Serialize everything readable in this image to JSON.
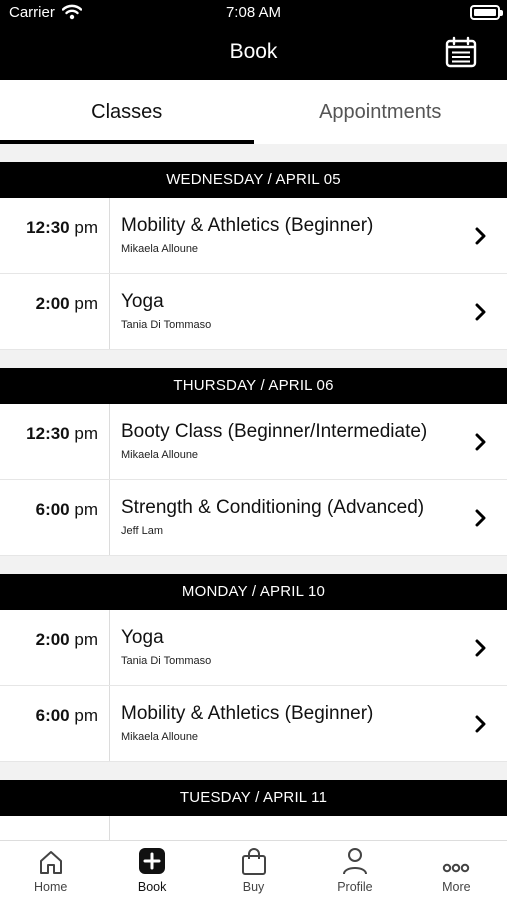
{
  "status_bar": {
    "carrier": "Carrier",
    "time": "7:08 AM"
  },
  "header": {
    "title": "Book"
  },
  "tabs": [
    {
      "label": "Classes",
      "active": true
    },
    {
      "label": "Appointments",
      "active": false
    }
  ],
  "days": [
    {
      "header": "WEDNESDAY / APRIL 05",
      "classes": [
        {
          "time": "12:30",
          "ampm": "pm",
          "name": "Mobility & Athletics (Beginner)",
          "instructor": "Mikaela Alloune"
        },
        {
          "time": "2:00",
          "ampm": "pm",
          "name": "Yoga",
          "instructor": "Tania Di Tommaso"
        }
      ]
    },
    {
      "header": "THURSDAY / APRIL 06",
      "classes": [
        {
          "time": "12:30",
          "ampm": "pm",
          "name": "Booty Class (Beginner/Intermediate)",
          "instructor": "Mikaela Alloune"
        },
        {
          "time": "6:00",
          "ampm": "pm",
          "name": "Strength & Conditioning (Advanced)",
          "instructor": "Jeff Lam"
        }
      ]
    },
    {
      "header": "MONDAY / APRIL 10",
      "classes": [
        {
          "time": "2:00",
          "ampm": "pm",
          "name": "Yoga",
          "instructor": "Tania Di Tommaso"
        },
        {
          "time": "6:00",
          "ampm": "pm",
          "name": "Mobility & Athletics (Beginner)",
          "instructor": "Mikaela Alloune"
        }
      ]
    },
    {
      "header": "TUESDAY / APRIL 11",
      "classes": []
    }
  ],
  "tab_bar": [
    {
      "label": "Home",
      "icon": "home-icon",
      "selected": false
    },
    {
      "label": "Book",
      "icon": "plus-box-icon",
      "selected": true
    },
    {
      "label": "Buy",
      "icon": "shopping-bag-icon",
      "selected": false
    },
    {
      "label": "Profile",
      "icon": "person-icon",
      "selected": false
    },
    {
      "label": "More",
      "icon": "ellipsis-icon",
      "selected": false
    }
  ]
}
